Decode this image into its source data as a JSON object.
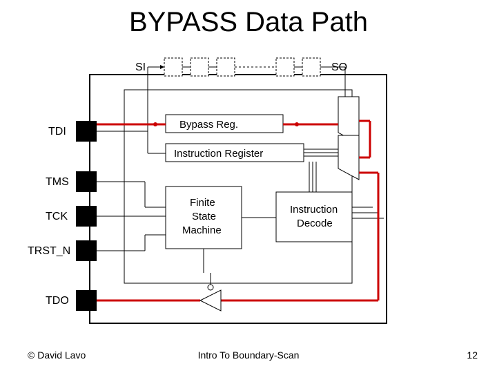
{
  "title": "BYPASS Data Path",
  "labels": {
    "si": "SI",
    "so": "SO",
    "tdi": "TDI",
    "tms": "TMS",
    "tck": "TCK",
    "trst_n": "TRST_N",
    "tdo": "TDO",
    "bypass_reg": "Bypass Reg.",
    "instruction_register": "Instruction Register",
    "fsm_l1": "Finite",
    "fsm_l2": "State",
    "fsm_l3": "Machine",
    "decode_l1": "Instruction",
    "decode_l2": "Decode"
  },
  "footer": {
    "left": "© David Lavo",
    "center": "Intro To Boundary-Scan",
    "right": "12"
  },
  "colors": {
    "highlight": "#cc0000",
    "block_fill": "#ffffff",
    "stroke": "#000000"
  }
}
